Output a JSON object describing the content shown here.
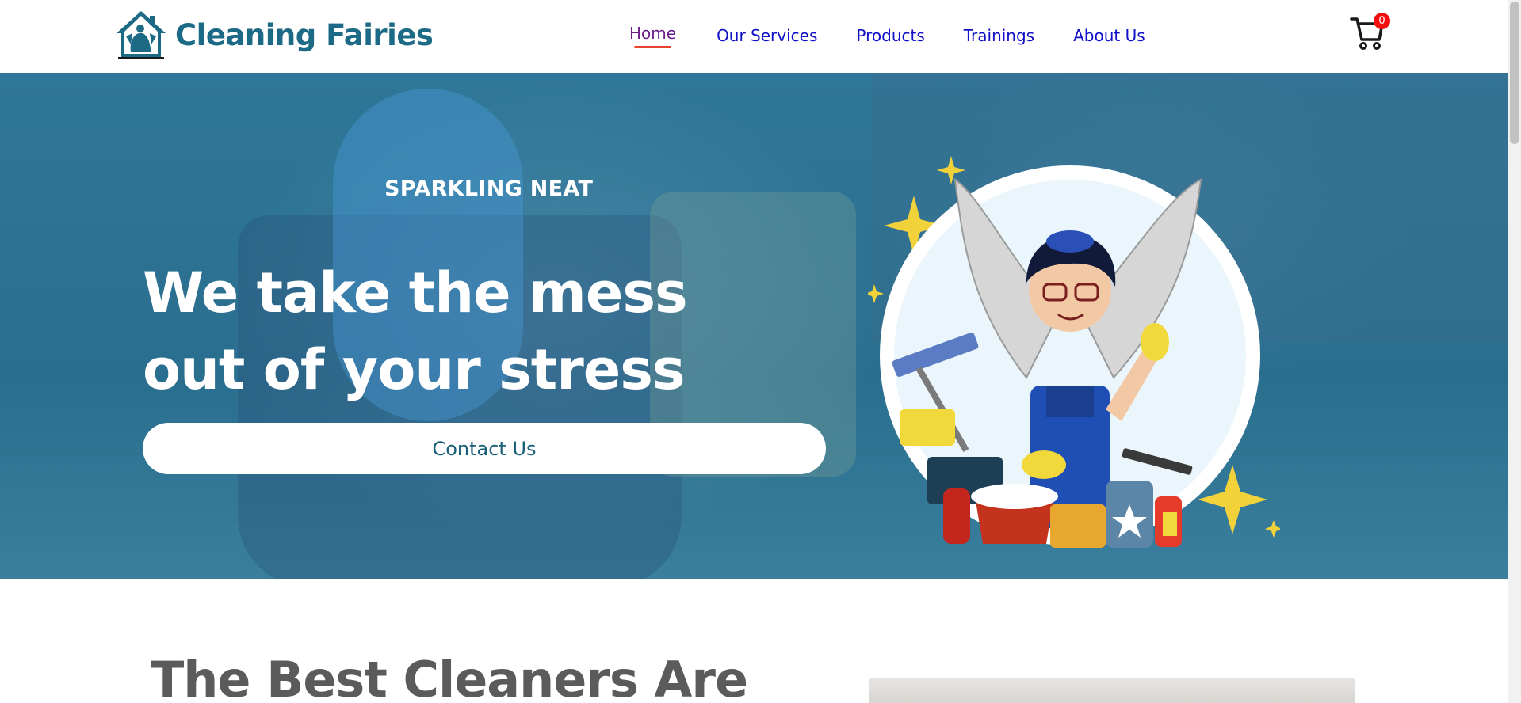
{
  "brand": {
    "name": "Cleaning Fairies"
  },
  "nav": {
    "items": [
      {
        "label": "Home",
        "active": true
      },
      {
        "label": "Our Services",
        "active": false
      },
      {
        "label": "Products",
        "active": false
      },
      {
        "label": "Trainings",
        "active": false
      },
      {
        "label": "About Us",
        "active": false
      }
    ]
  },
  "cart": {
    "count": "0",
    "icon": "cart-icon"
  },
  "hero": {
    "kicker": "SPARKLING NEAT",
    "headline_line1": "We take the mess",
    "headline_line2": "out of your stress",
    "cta_label": "Contact Us"
  },
  "section": {
    "title": "The Best Cleaners Are"
  },
  "colors": {
    "brand": "#1d6a86",
    "nav_link": "#1010c8",
    "nav_active": "#6a1f8a",
    "nav_underline": "#e8432e",
    "hero_overlay": "#2f7798",
    "badge": "#f30d0d",
    "section_title": "#5b5b5b"
  }
}
